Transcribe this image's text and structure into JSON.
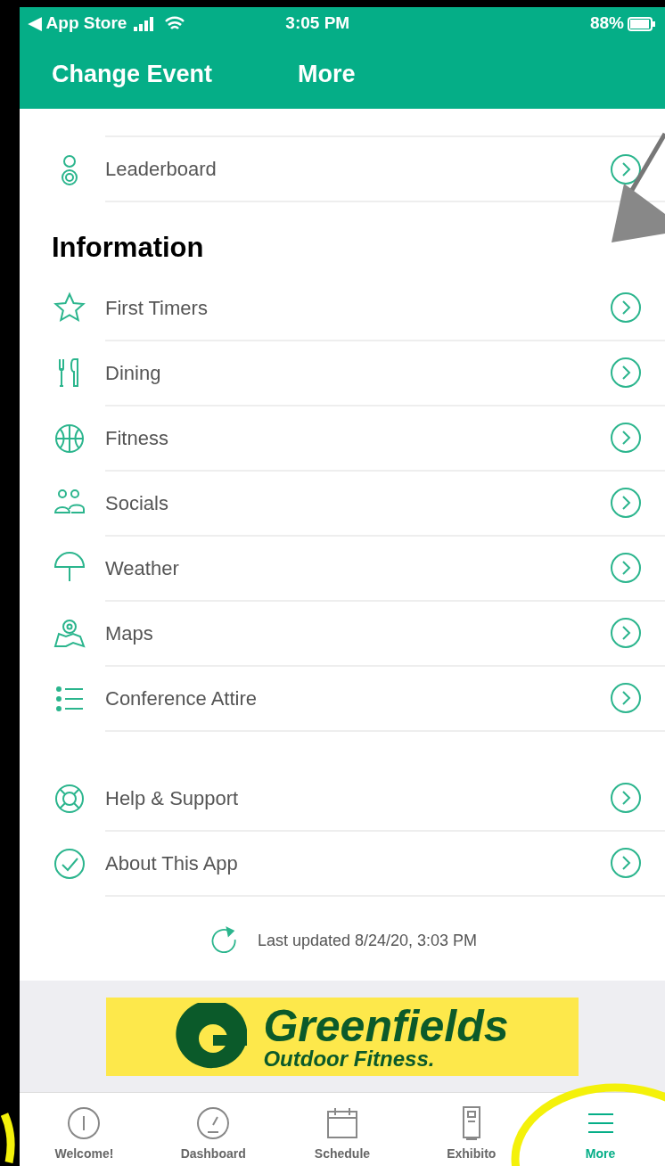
{
  "status_bar": {
    "carrier": "◀ App Store",
    "time": "3:05 PM",
    "battery": "88%"
  },
  "header": {
    "back_label": "Change Event",
    "title": "More"
  },
  "sections": [
    {
      "items": [
        {
          "label": "Leaderboard"
        }
      ]
    },
    {
      "heading": "Information",
      "items": [
        {
          "label": "First Timers"
        },
        {
          "label": "Dining"
        },
        {
          "label": "Fitness"
        },
        {
          "label": "Socials"
        },
        {
          "label": "Weather"
        },
        {
          "label": "Maps"
        },
        {
          "label": "Conference Attire"
        }
      ]
    },
    {
      "items": [
        {
          "label": "Help & Support"
        },
        {
          "label": "About This App"
        }
      ]
    }
  ],
  "last_updated": "Last updated 8/24/20, 3:03 PM",
  "banner": {
    "name": "Greenfields",
    "tagline": "Outdoor Fitness."
  },
  "tabs": [
    {
      "label": "Welcome!",
      "selected": false
    },
    {
      "label": "Dashboard",
      "selected": false
    },
    {
      "label": "Schedule",
      "selected": false
    },
    {
      "label": "Exhibito",
      "selected": false
    },
    {
      "label": "More",
      "selected": true
    }
  ],
  "annotations": [
    {
      "kind": "arrow"
    },
    {
      "kind": "circle"
    },
    {
      "kind": "circle"
    }
  ]
}
